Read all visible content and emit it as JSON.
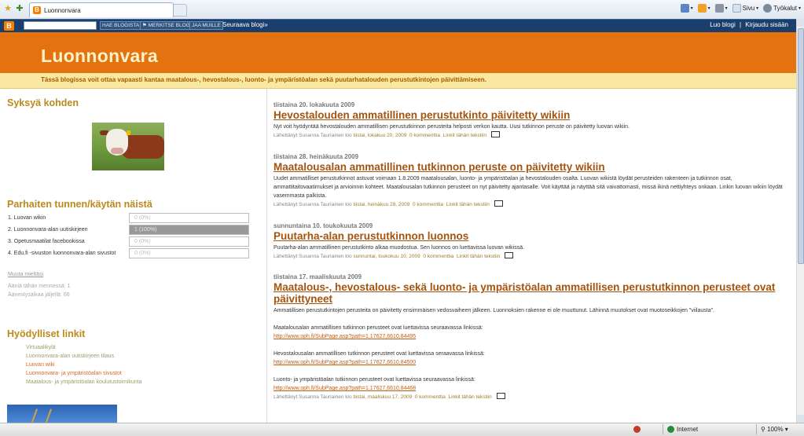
{
  "browser": {
    "tab_title": "Luonnonvara",
    "cmd_page": "Sivu",
    "cmd_tools": "Työkalut",
    "status_zone": "Internet",
    "status_zoom": "100%"
  },
  "navbar": {
    "search_button": "HAE BLOGISTA",
    "flag_button": "MERKITSE BLOGI",
    "share_button": "JAA MUILLE",
    "next_blog": "Seuraava blogi»",
    "create_blog": "Luo blogi",
    "sign_in": "Kirjaudu sisään",
    "separator": "|"
  },
  "header": {
    "title": "Luonnonvara",
    "description": "Tässä blogissa voit ottaa vapaasti kantaa maatalous-, hevostalous-, luonto- ja ympäristöalan sekä puutarhatalouden perustutkintojen päivittämiseen."
  },
  "sidebar": {
    "section1_title": "Syksyä kohden",
    "poll_title": "Parhaiten tunnen/käytän näistä",
    "poll": [
      {
        "label": "1. Luovan wikin",
        "pct": "0 (0%)",
        "value": 0
      },
      {
        "label": "2. Luonnonvara-alan uutiskirjeen",
        "pct": "1 (100%)",
        "value": 100
      },
      {
        "label": "3. Opetusmaatilat facebookissa",
        "pct": "0 (0%)",
        "value": 0
      },
      {
        "label": "4. Edu.fi -sivuston luonnonvara-alan sivustot",
        "pct": "0 (0%)",
        "value": 0
      }
    ],
    "poll_change": "Muuta mieltäsi",
    "poll_votes": "Ääniä tähän mennessä: 1",
    "poll_days": "Äänestysaikaa jäljellä: 66",
    "links_title": "Hyödylliset linkit",
    "links": [
      "Virtuaalikylä",
      "Luonnonvara-alan uutiskirjeen tilaus",
      "Luovan wiki",
      "Luonnonvara- ja ympäristöalan sivustot",
      "Maatalous- ja ympäristöalan koulutustoimikunta"
    ]
  },
  "posts": [
    {
      "date": "tiistaina 20. lokakuuta 2009",
      "title": "Hevostalouden ammatillinen perustutkinto päivitetty wikiin",
      "body": "Nyt voit hyödyntää hevostalouden ammatillisen perustutkinnon perusteita helposti verkon kautta. Uusi tutkinnon peruste on päivitetty luovan wikiin.",
      "footer_by": "Lähettänyt Susanna Tauriainen klo",
      "footer_time": "tiistai, lokakuu 20, 2009",
      "footer_comments": "0 kommenttia",
      "footer_link": "Linkit tähän tekstiin"
    },
    {
      "date": "tiistaina 28. heinäkuuta 2009",
      "title": "Maatalousalan ammatillinen tutkinnon peruste on päivitetty wikiin",
      "body": "Uudet ammatilliset perustutkinnot astuvat voimaan 1.8.2009 maatalousalan, luonto- ja ympäristöalan ja hevostalouden osalta. Luovan wikistä löydät perusteiden rakenteen ja tutkinnon osat, ammattitaitovaatimukset ja arvioinnin kohteet. Maatalousalan tutkinnon perusteet on nyt päivitetty ajantasalle. Voit käyttää ja näyttää sitä vaivattomasti, missä ikinä nettiyhteys onkaan. Linkin luovan wikiin löydät vasemmasta palkista.",
      "footer_by": "Lähettänyt Susanna Tauriainen klo",
      "footer_time": "tiistai, heinäkuu 28, 2009",
      "footer_comments": "0 kommenttia",
      "footer_link": "Linkit tähän tekstiin"
    },
    {
      "date": "sunnuntaina 10. toukokuuta 2009",
      "title": "Puutarha-alan perustutkinnon luonnos",
      "body": "Puutarha-alan ammatillinen perustutkinto alkaa muodostua. Sen luonnos on luettavissa luovan wikissä.",
      "footer_by": "Lähettänyt Susanna Tauriainen klo",
      "footer_time": "sunnuntai, toukokuu 10, 2009",
      "footer_comments": "0 kommenttia",
      "footer_link": "Linkit tähän tekstiin"
    },
    {
      "date": "tiistaina 17. maaliskuuta 2009",
      "title": "Maatalous-, hevostalous- sekä luonto- ja ympäristöalan ammatillisen perustutkinnon perusteet ovat päivittyneet",
      "body": "Ammatillisen perustutkintojen perusteita on päivitetty ensimmäisen vedosvaiheen jälkeen. Luonnoksien rakenne ei ole muuttunut. Lähinnä muutokset ovat muotoseikkojen \"viilausta\".",
      "para1": "Maatalousalan ammatillisen tutkinnon perusteet ovat luettavissa seuraavassa linkissä:",
      "link1": "http://www.oph.fi/SubPage.asp?path=1,17627,6610,84495",
      "para2": "Hevostalousalan ammatillisen tutkinnon perusteet ovat luettavissa seraavassa linkissä:",
      "link2": "http://www.oph.fi/SubPage.asp?path=1,17627,6610,84500",
      "para3": "Luonto- ja ympäristöalan tutkinnon perusteet ovat luettavissa seuraavassa linkissä:",
      "link3": "http://www.oph.fi/SubPage.asp?path=1,17627,6610,84468",
      "footer_by": "Lähettänyt Susanna Tauriainen klo",
      "footer_time": "tiistai, maaliskuu 17, 2009",
      "footer_comments": "0 kommenttia",
      "footer_link": "Linkit tähän tekstiin"
    }
  ]
}
